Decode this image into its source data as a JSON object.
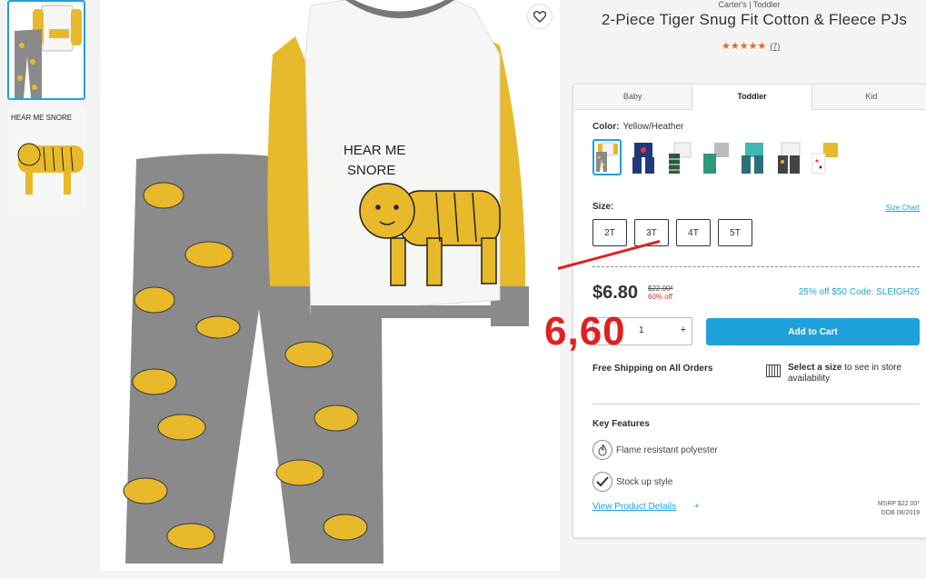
{
  "header": {
    "brand_line": "Carter's | Toddler",
    "title": "2-Piece Tiger Snug Fit Cotton & Fleece PJs",
    "stars": "★★★★★",
    "review_count": "(7)"
  },
  "main_image": {
    "print_text": "HEAR ME\nSNORE"
  },
  "thumb_text": "HEAR ME SNORE",
  "tabs": [
    "Baby",
    "Toddler",
    "Kid"
  ],
  "color": {
    "label": "Color:",
    "value": "Yellow/Heather"
  },
  "swatch_colors": [
    "#e7b92b",
    "#1f3a7a",
    "#2b5a3a",
    "#2e9a7e",
    "#3fb8b0",
    "#444444",
    "#e7b92b"
  ],
  "size": {
    "label": "Size:",
    "chart_link": "Size Chart",
    "options": [
      "2T",
      "3T",
      "4T",
      "5T"
    ]
  },
  "price": {
    "current": "$6.80",
    "original": "$22.00*",
    "discount": "60% off",
    "promo": "25% off $50 Code: SLEIGH25"
  },
  "quantity": {
    "value": "1",
    "plus": "+"
  },
  "add_to_cart": "Add to Cart",
  "shipping": {
    "text": "Free Shipping on All Orders"
  },
  "store": {
    "bold": "Select a size",
    "rest": " to see in store availability"
  },
  "key_features": {
    "title": "Key Features",
    "items": [
      "Flame resistant polyester",
      "Stock up style"
    ]
  },
  "details_link": "View Product Details",
  "details_plus": "+",
  "msrp": {
    "line1": "MSRP $22.00*",
    "line2": "DOB 08/2019"
  },
  "overlay": {
    "text": "6,60"
  },
  "colors": {
    "accent": "#1fa1d9",
    "overlay_red": "#e02020",
    "star": "#e36a1f",
    "garment_yellow": "#e7b92b",
    "garment_grey": "#8a8a8a"
  }
}
